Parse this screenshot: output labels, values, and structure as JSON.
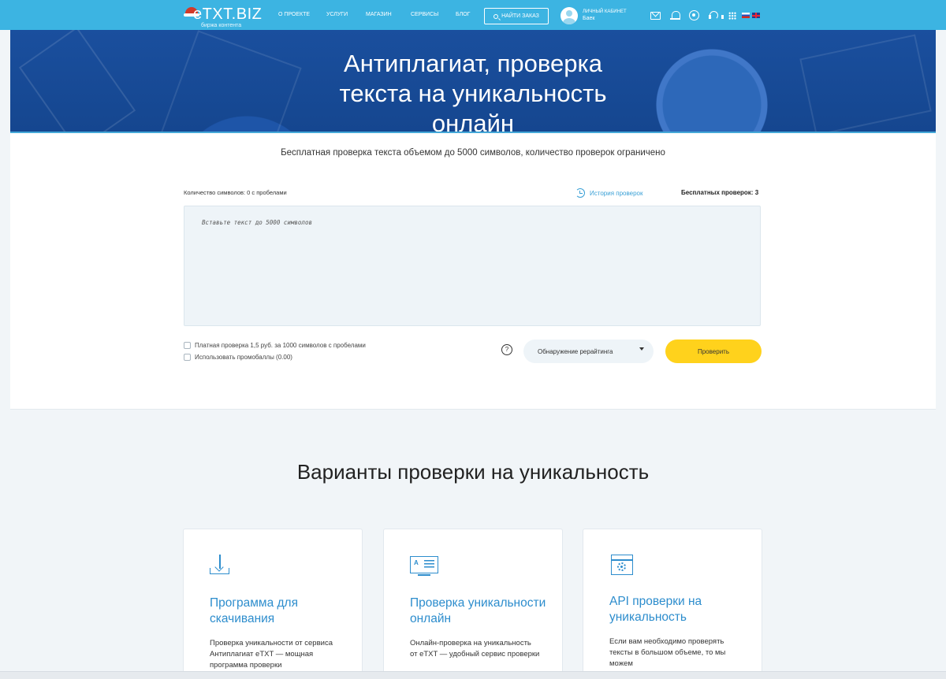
{
  "header": {
    "logo_text": "eTXT.BIZ",
    "logo_subtitle": "биржа контента",
    "nav": [
      "О ПРОЕКТЕ",
      "УСЛУГИ",
      "МАГАЗИН",
      "СЕРВИСЫ",
      "БЛОГ"
    ],
    "find_order_label": "НАЙТИ ЗАКАЗ",
    "account_label": "ЛИЧНЫЙ КАБИНЕТ",
    "account_name": "Баек"
  },
  "hero": {
    "title_lines": [
      "Антиплагиат, проверка",
      "текста на уникальность",
      "онлайн"
    ]
  },
  "checker": {
    "subtitle": "Бесплатная проверка текста объемом до 5000 символов, количество проверок ограничено",
    "char_count": "Количество символов: 0 с пробелами",
    "history_label": "История проверок",
    "free_checks": "Бесплатных проверок: 3",
    "textarea_placeholder": "Вставьте текст до 5000 символов",
    "option_paid": "Платная проверка 1,5 руб. за 1000 символов с пробелами",
    "option_promo": "Использовать промобаллы (0.00)",
    "help_symbol": "?",
    "mode_selected": "Обнаружение рерайтинга",
    "check_button": "Проверить"
  },
  "variants": {
    "title": "Варианты проверки на уникальность",
    "cards": [
      {
        "icon": "download-icon",
        "title": "Программа для скачивания",
        "text": "Проверка уникальности от сервиса Антиплагиат eTXT — мощная программа проверки"
      },
      {
        "icon": "document-online-icon",
        "title": "Проверка уникальности онлайн",
        "text": "Онлайн-проверка на уникальность от eTXT — удобный сервис проверки"
      },
      {
        "icon": "api-settings-icon",
        "title": "API проверки на уникальность",
        "text": "Если вам необходимо проверять тексты в большом объеме, то мы можем"
      }
    ]
  },
  "colors": {
    "topbar": "#3cb4e2",
    "hero": "#1a4f9e",
    "accent_blue": "#2d8dcd",
    "button_yellow": "#ffd21c"
  }
}
